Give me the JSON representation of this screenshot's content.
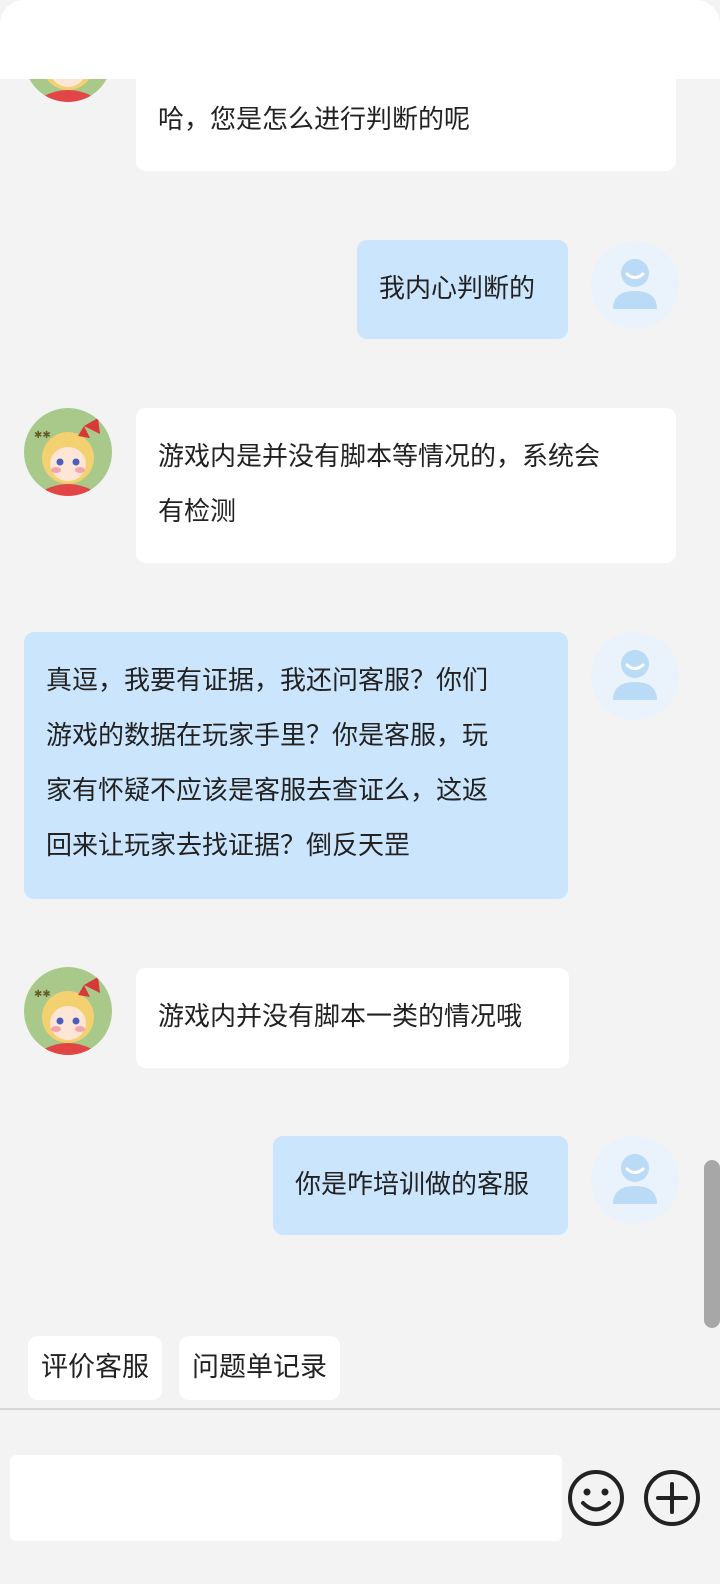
{
  "messages": [
    {
      "sender": "agent",
      "lines": [
        "哈，您是怎么进行判断的呢"
      ]
    },
    {
      "sender": "user",
      "lines": [
        "我内心判断的"
      ]
    },
    {
      "sender": "agent",
      "lines": [
        "游戏内是并没有脚本等情况的，系统会",
        "有检测"
      ]
    },
    {
      "sender": "user",
      "lines": [
        "真逗，我要有证据，我还问客服？你们",
        "游戏的数据在玩家手里？你是客服，玩",
        "家有怀疑不应该是客服去查证么，这返",
        "回来让玩家去找证据？倒反天罡"
      ]
    },
    {
      "sender": "agent",
      "lines": [
        "游戏内并没有脚本一类的情况哦"
      ]
    },
    {
      "sender": "user",
      "lines": [
        "你是咋培训做的客服"
      ]
    }
  ],
  "quick_actions": {
    "rate": "评价客服",
    "tickets": "问题单记录"
  },
  "input": {
    "value": "",
    "placeholder": ""
  },
  "icons": {
    "emoji": "smiley-icon",
    "more": "plus-circle-icon"
  },
  "colors": {
    "agent_bubble": "#ffffff",
    "user_bubble": "#cbe5fc",
    "background": "#f3f3f3",
    "user_avatar": "#b9dbf6"
  }
}
